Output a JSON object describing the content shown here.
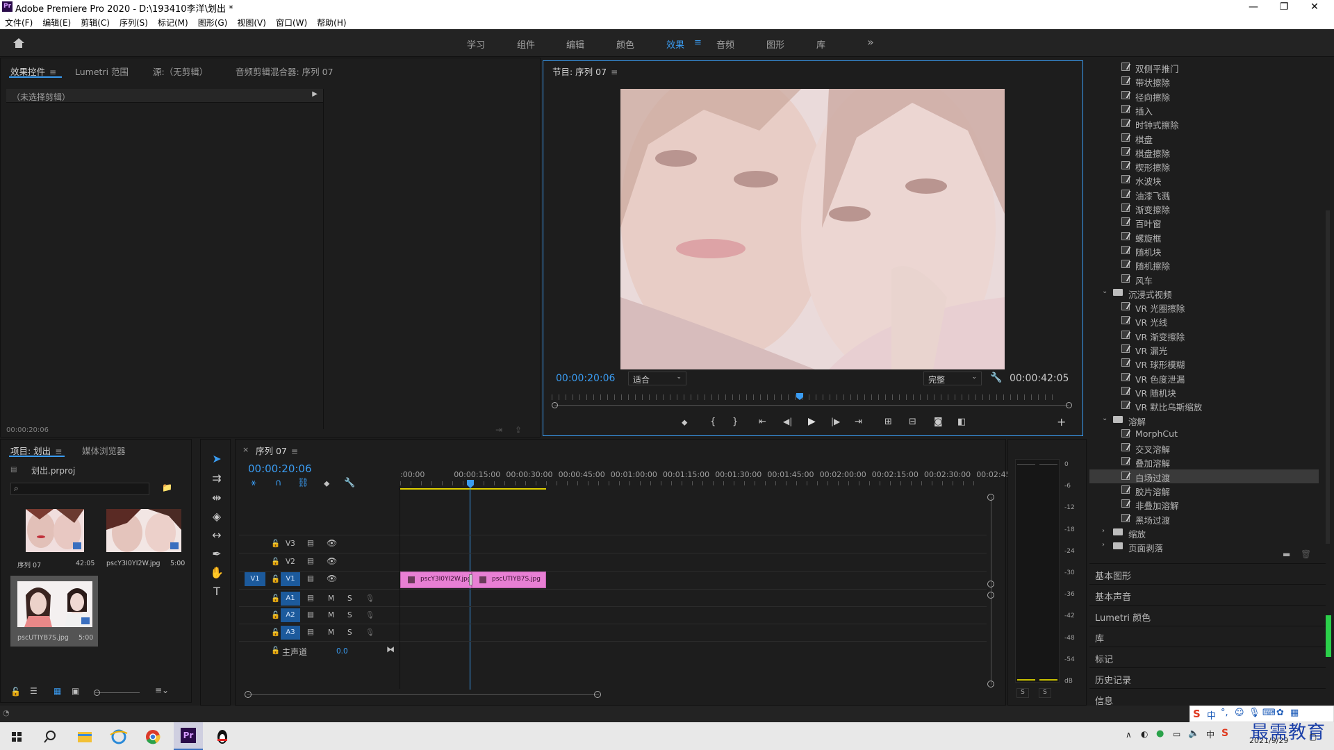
{
  "app": {
    "title": "Adobe Premiere Pro 2020 - D:\\193410李洋\\划出 *",
    "window_controls": {
      "minimize": "—",
      "maximize": "❐",
      "close": "✕"
    }
  },
  "menu": [
    "文件(F)",
    "编辑(E)",
    "剪辑(C)",
    "序列(S)",
    "标记(M)",
    "图形(G)",
    "视图(V)",
    "窗口(W)",
    "帮助(H)"
  ],
  "workspaces": {
    "items": [
      "学习",
      "组件",
      "编辑",
      "颜色",
      "效果",
      "音频",
      "图形",
      "库"
    ],
    "active": "效果",
    "more": "»"
  },
  "effect_controls": {
    "tabs": [
      "效果控件",
      "Lumetri 范围",
      "源:（无剪辑）",
      "音频剪辑混合器: 序列 07"
    ],
    "no_clip": "（未选择剪辑）",
    "timecode": "00:00:20:06"
  },
  "program": {
    "title": "节目: 序列 07",
    "timecode_left": "00:00:20:06",
    "fit": "适合",
    "quality": "完整",
    "timecode_right": "00:00:42:05"
  },
  "effects_list": [
    {
      "t": "item",
      "name": "双侧平推门"
    },
    {
      "t": "item",
      "name": "带状擦除"
    },
    {
      "t": "item",
      "name": "径向擦除"
    },
    {
      "t": "item",
      "name": "插入"
    },
    {
      "t": "item",
      "name": "时钟式擦除"
    },
    {
      "t": "item",
      "name": "棋盘"
    },
    {
      "t": "item",
      "name": "棋盘擦除"
    },
    {
      "t": "item",
      "name": "楔形擦除"
    },
    {
      "t": "item",
      "name": "水波块"
    },
    {
      "t": "item",
      "name": "油漆飞溅"
    },
    {
      "t": "item",
      "name": "渐变擦除"
    },
    {
      "t": "item",
      "name": "百叶窗"
    },
    {
      "t": "item",
      "name": "螺旋框"
    },
    {
      "t": "item",
      "name": "随机块"
    },
    {
      "t": "item",
      "name": "随机擦除"
    },
    {
      "t": "item",
      "name": "风车"
    },
    {
      "t": "folder",
      "name": "沉浸式视频",
      "open": true
    },
    {
      "t": "item",
      "name": "VR 光圈擦除"
    },
    {
      "t": "item",
      "name": "VR 光线"
    },
    {
      "t": "item",
      "name": "VR 渐变擦除"
    },
    {
      "t": "item",
      "name": "VR 漏光"
    },
    {
      "t": "item",
      "name": "VR 球形模糊"
    },
    {
      "t": "item",
      "name": "VR 色度泄漏"
    },
    {
      "t": "item",
      "name": "VR 随机块"
    },
    {
      "t": "item",
      "name": "VR 默比乌斯缩放"
    },
    {
      "t": "folder",
      "name": "溶解",
      "open": true
    },
    {
      "t": "item",
      "name": "MorphCut"
    },
    {
      "t": "item",
      "name": "交叉溶解"
    },
    {
      "t": "item",
      "name": "叠加溶解"
    },
    {
      "t": "item",
      "name": "白场过渡",
      "selected": true
    },
    {
      "t": "item",
      "name": "胶片溶解"
    },
    {
      "t": "item",
      "name": "非叠加溶解"
    },
    {
      "t": "item",
      "name": "黑场过渡"
    },
    {
      "t": "folder",
      "name": "缩放",
      "open": false
    },
    {
      "t": "folder",
      "name": "页面剥落",
      "open": false
    }
  ],
  "side_panels": [
    "基本图形",
    "基本声音",
    "Lumetri 颜色",
    "库",
    "标记",
    "历史记录",
    "信息"
  ],
  "project": {
    "tabs": [
      "项目: 划出",
      "媒体浏览器"
    ],
    "file": "划出.prproj",
    "items": [
      {
        "name": "序列 07",
        "dur": "42:05"
      },
      {
        "name": "pscY3I0YI2W.jpg",
        "dur": "5:00"
      },
      {
        "name": "pscUTIYB7S.jpg",
        "dur": "5:00"
      }
    ]
  },
  "timeline": {
    "tab": "序列 07",
    "timecode": "00:00:20:06",
    "ruler": [
      ":00:00",
      "00:00:15:00",
      "00:00:30:00",
      "00:00:45:00",
      "00:01:00:00",
      "00:01:15:00",
      "00:01:30:00",
      "00:01:45:00",
      "00:02:00:00",
      "00:02:15:00",
      "00:02:30:00",
      "00:02:45:"
    ],
    "video_tracks": [
      "V3",
      "V2",
      "V1"
    ],
    "audio_tracks": [
      "A1",
      "A2",
      "A3"
    ],
    "source_v1": "V1",
    "master": "主声道",
    "master_val": "0.0",
    "ms": {
      "m": "M",
      "s": "S"
    },
    "clips": [
      "pscY3I0YI2W.jpg",
      "pscUTIYB7S.jpg"
    ]
  },
  "meter": {
    "labels": [
      "0",
      "-6",
      "-12",
      "-18",
      "-24",
      "-30",
      "-36",
      "-42",
      "-48",
      "-54",
      "dB"
    ],
    "solo": [
      "S",
      "S"
    ]
  },
  "taskbar": {
    "date": "2021/9/29",
    "watermark": "最需教育",
    "ime": "中"
  }
}
